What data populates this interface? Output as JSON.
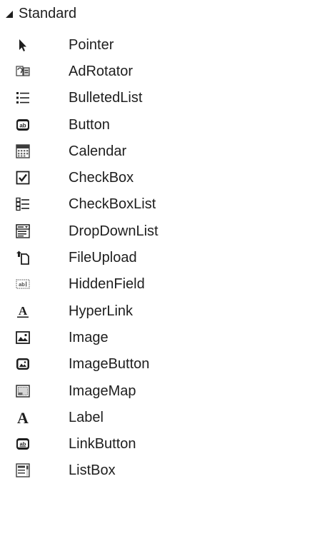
{
  "toolbox": {
    "group_label": "Standard",
    "items": [
      {
        "label": "Pointer",
        "icon": "pointer-icon"
      },
      {
        "label": "AdRotator",
        "icon": "adrotator-icon"
      },
      {
        "label": "BulletedList",
        "icon": "bulleted-list-icon"
      },
      {
        "label": "Button",
        "icon": "button-icon"
      },
      {
        "label": "Calendar",
        "icon": "calendar-icon"
      },
      {
        "label": "CheckBox",
        "icon": "checkbox-icon"
      },
      {
        "label": "CheckBoxList",
        "icon": "checkbox-list-icon"
      },
      {
        "label": "DropDownList",
        "icon": "dropdown-list-icon"
      },
      {
        "label": "FileUpload",
        "icon": "file-upload-icon"
      },
      {
        "label": "HiddenField",
        "icon": "hidden-field-icon"
      },
      {
        "label": "HyperLink",
        "icon": "hyperlink-icon"
      },
      {
        "label": "Image",
        "icon": "image-icon"
      },
      {
        "label": "ImageButton",
        "icon": "image-button-icon"
      },
      {
        "label": "ImageMap",
        "icon": "image-map-icon"
      },
      {
        "label": "Label",
        "icon": "label-icon"
      },
      {
        "label": "LinkButton",
        "icon": "link-button-icon"
      },
      {
        "label": "ListBox",
        "icon": "listbox-icon"
      }
    ]
  }
}
